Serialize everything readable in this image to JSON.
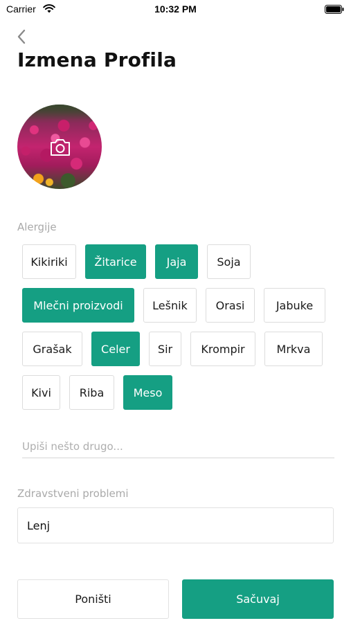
{
  "status_bar": {
    "carrier": "Carrier",
    "time": "10:32 PM"
  },
  "header": {
    "back_icon": "chevron-left-icon",
    "title": "Izmena Profila"
  },
  "avatar": {
    "overlay_icon": "camera-icon"
  },
  "allergies": {
    "label": "Alergije",
    "chips": [
      {
        "label": "Kikiriki",
        "selected": false
      },
      {
        "label": "Žitarice",
        "selected": true
      },
      {
        "label": "Jaja",
        "selected": true
      },
      {
        "label": "Soja",
        "selected": false
      },
      {
        "label": "Mlečni proizvodi",
        "selected": true
      },
      {
        "label": "Lešnik",
        "selected": false
      },
      {
        "label": "Orasi",
        "selected": false
      },
      {
        "label": "Jabuke",
        "selected": false
      },
      {
        "label": "Grašak",
        "selected": false
      },
      {
        "label": "Celer",
        "selected": true
      },
      {
        "label": "Sir",
        "selected": false
      },
      {
        "label": "Krompir",
        "selected": false
      },
      {
        "label": "Mrkva",
        "selected": false
      },
      {
        "label": "Kivi",
        "selected": false
      },
      {
        "label": "Riba",
        "selected": false
      },
      {
        "label": "Meso",
        "selected": true
      }
    ],
    "other_placeholder": "Upiši nešto drugo..."
  },
  "health": {
    "label": "Zdravstveni problemi",
    "value": "Lenj"
  },
  "actions": {
    "cancel_label": "Poništi",
    "save_label": "Sačuvaj"
  },
  "colors": {
    "accent": "#159f83",
    "chip_border": "#dcdcdc",
    "label_gray": "#a9a9a9"
  }
}
